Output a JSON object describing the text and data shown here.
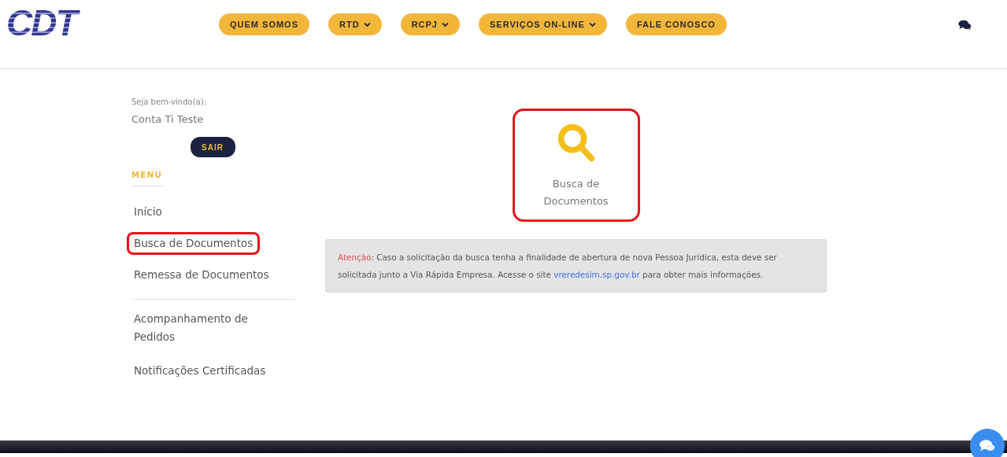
{
  "logo": {
    "text": "CDT"
  },
  "nav": [
    {
      "label": "QUEM SOMOS",
      "dropdown": false
    },
    {
      "label": "RTD",
      "dropdown": true
    },
    {
      "label": "RCPJ",
      "dropdown": true
    },
    {
      "label": "SERVIÇOS ON-LINE",
      "dropdown": true
    },
    {
      "label": "FALE CONOSCO",
      "dropdown": false
    }
  ],
  "sidebar": {
    "welcome": "Seja bem-vindo(a):",
    "user": "Conta Ti Teste",
    "logout": "SAIR",
    "menu_title": "MENU",
    "groups": [
      [
        {
          "label": "Início",
          "highlighted": false
        },
        {
          "label": "Busca de Documentos",
          "highlighted": true
        },
        {
          "label": "Remessa de Documentos",
          "highlighted": false
        }
      ],
      [
        {
          "label": "Acompanhamento de Pedidos",
          "highlighted": false
        },
        {
          "label": "Notificações Certificadas",
          "highlighted": false
        }
      ]
    ]
  },
  "cards": [
    {
      "label": "Busca de Documentos",
      "highlighted": true
    }
  ],
  "notice": {
    "label": "Atenção",
    "text_before": ": Caso a solicitação da busca tenha a finalidade de abertura de nova Pessoa Jurídica, esta deve ser solicitada junto a Via Rápida Empresa. Acesse o site ",
    "link": "vreredesim.sp.gov.br",
    "text_after": " para obter mais informações."
  }
}
